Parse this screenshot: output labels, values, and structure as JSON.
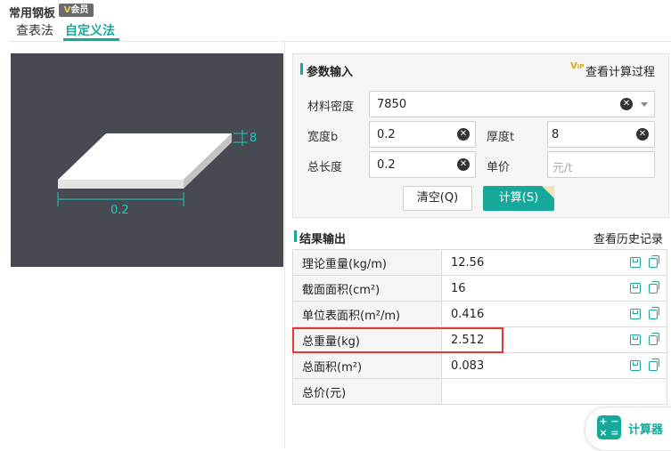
{
  "header": {
    "title": "常用钢板",
    "vip_badge": "会员",
    "tabs": [
      "查表法",
      "自定义法"
    ],
    "active_tab": "自定义法"
  },
  "preview": {
    "width_label": "0.2",
    "thickness_label": "8"
  },
  "params": {
    "title": "参数输入",
    "view_process": "查看计算过程",
    "density_label": "材料密度",
    "density_value": "7850",
    "width_label": "宽度b",
    "width_value": "0.2",
    "thickness_label": "厚度t",
    "thickness_value": "8",
    "length_label": "总长度",
    "length_value": "0.2",
    "price_label": "单价",
    "price_placeholder": "元/t",
    "clear_button": "清空(Q)",
    "calc_button": "计算(S)"
  },
  "results": {
    "title": "结果输出",
    "history_link": "查看历史记录",
    "rows": [
      {
        "name": "理论重量(kg/m)",
        "value": "12.56"
      },
      {
        "name": "截面面积(cm²)",
        "value": "16"
      },
      {
        "name": "单位表面积(m²/m)",
        "value": "0.416"
      },
      {
        "name": "总重量(kg)",
        "value": "2.512"
      },
      {
        "name": "总面积(m²)",
        "value": "0.083"
      },
      {
        "name": "总价(元)",
        "value": ""
      }
    ]
  },
  "calculator": {
    "label": "计算器"
  },
  "colors": {
    "accent": "#16a99b",
    "highlight": "#e53935",
    "preview_bg": "#474a52"
  }
}
